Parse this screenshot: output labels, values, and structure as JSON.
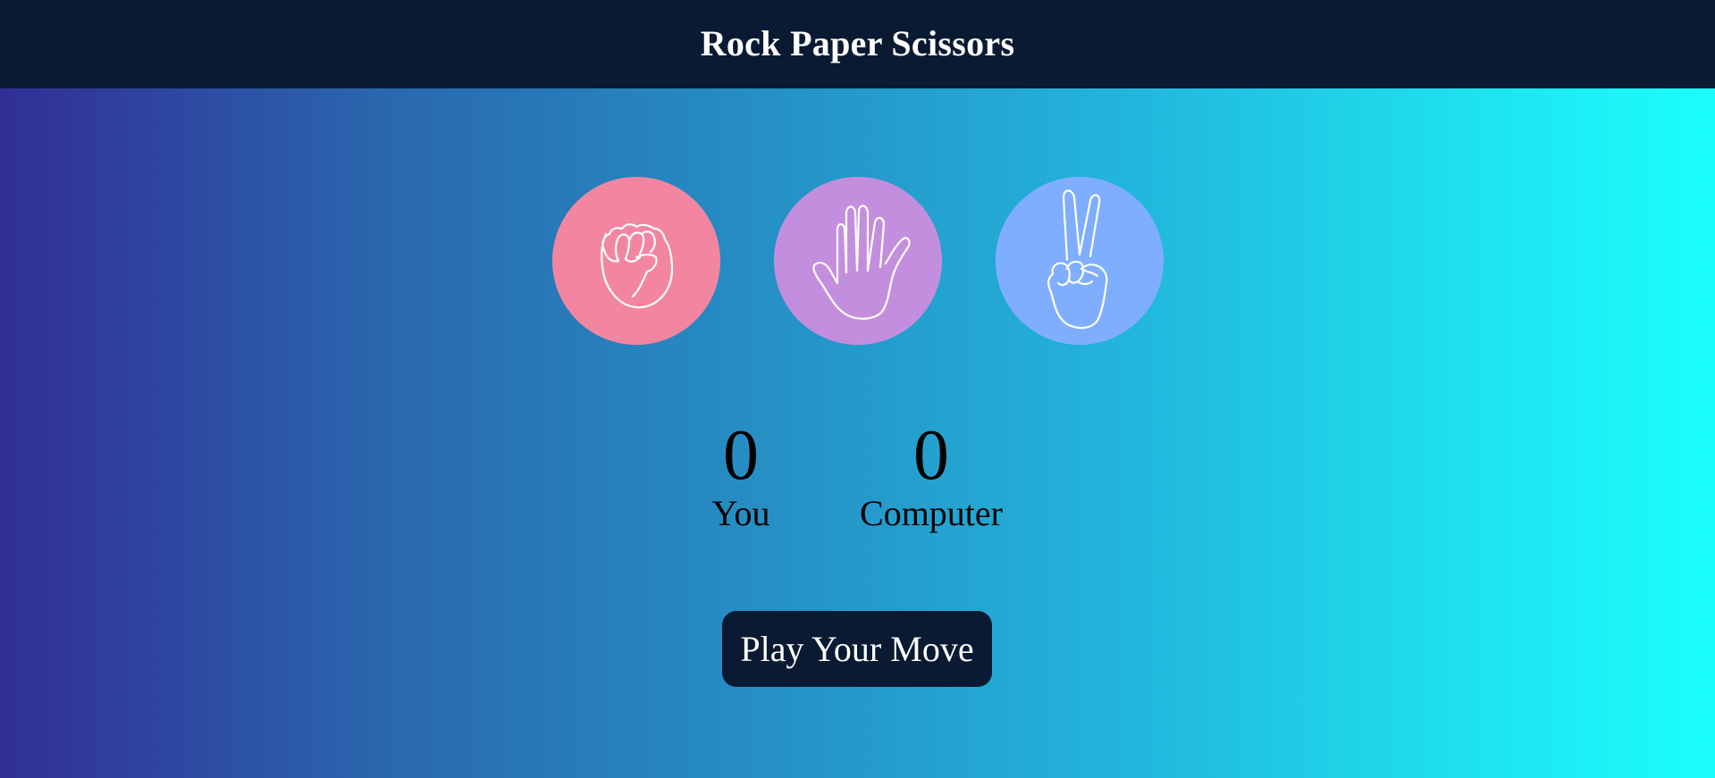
{
  "header": {
    "title": "Rock Paper Scissors"
  },
  "choices": [
    {
      "name": "rock",
      "icon": "fist-icon",
      "color": "#f286a1"
    },
    {
      "name": "paper",
      "icon": "open-hand-icon",
      "color": "#c48ede"
    },
    {
      "name": "scissors",
      "icon": "peace-hand-icon",
      "color": "#80aefe"
    }
  ],
  "scores": {
    "user": {
      "value": "0",
      "label": "You"
    },
    "computer": {
      "value": "0",
      "label": "Computer"
    }
  },
  "play_button": {
    "label": "Play Your Move"
  },
  "colors": {
    "navbar": "#0a1a33",
    "gradient_start": "#312e95",
    "gradient_end": "#1afffd"
  }
}
